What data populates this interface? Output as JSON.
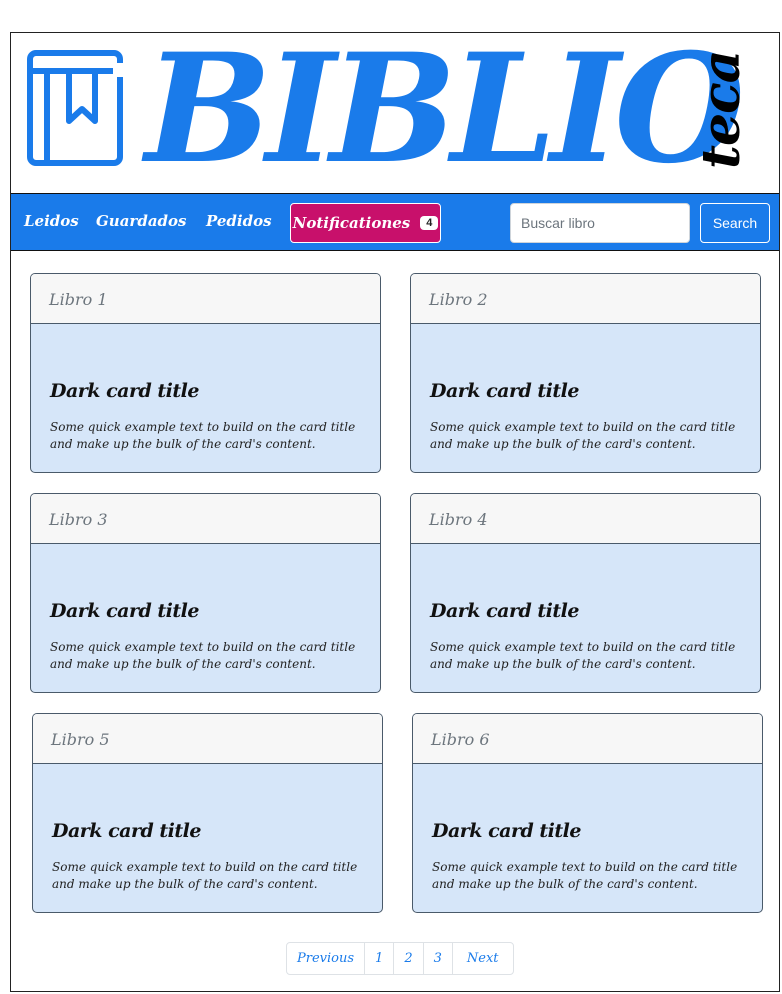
{
  "header": {
    "brand_main": "BIBLIO",
    "brand_sub": "teca",
    "logo_icon": "book-bookmark-icon"
  },
  "nav": {
    "links": [
      "Leidos",
      "Guardados",
      "Pedidos"
    ],
    "notifications_label": "Notificationes",
    "notifications_count": "4",
    "search_placeholder": "Buscar libro",
    "search_button": "Search"
  },
  "cards": [
    {
      "header": "Libro 1",
      "title": "Dark card title",
      "text": "Some quick example text to build on the card title and make up the bulk of the card's content."
    },
    {
      "header": "Libro 2",
      "title": "Dark card title",
      "text": "Some quick example text to build on the card title and make up the bulk of the card's content."
    },
    {
      "header": "Libro 3",
      "title": "Dark card title",
      "text": "Some quick example text to build on the card title and make up the bulk of the card's content."
    },
    {
      "header": "Libro 4",
      "title": "Dark card title",
      "text": "Some quick example text to build on the card title and make up the bulk of the card's content."
    },
    {
      "header": "Libro 5",
      "title": "Dark card title",
      "text": "Some quick example text to build on the card title and make up the bulk of the card's content."
    },
    {
      "header": "Libro 6",
      "title": "Dark card title",
      "text": "Some quick example text to build on the card title and make up the bulk of the card's content."
    }
  ],
  "pagination": {
    "previous": "Previous",
    "pages": [
      "1",
      "2",
      "3"
    ],
    "next": "Next"
  },
  "colors": {
    "primary": "#1a7bea",
    "notification": "#c8106b",
    "card_body": "#d6e6f9"
  }
}
